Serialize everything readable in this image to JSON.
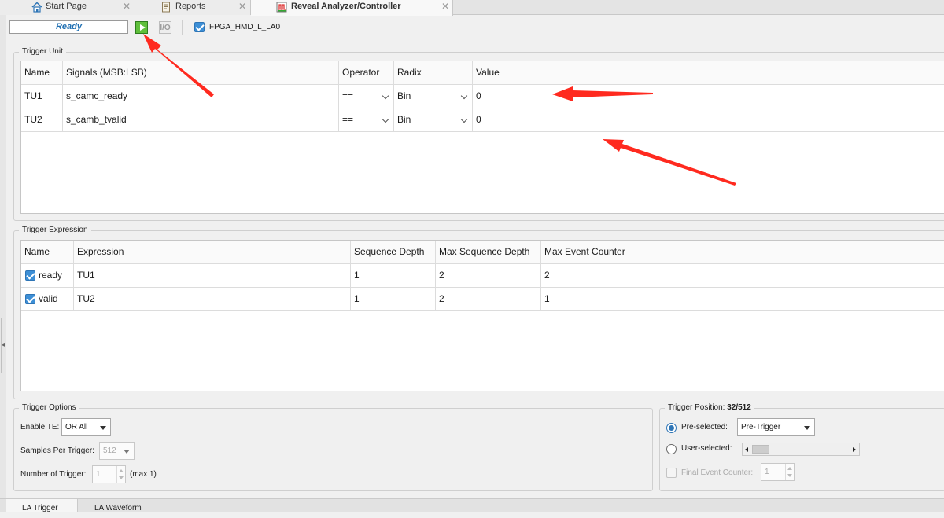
{
  "tabs": [
    {
      "label": "Start Page",
      "icon": "home-icon"
    },
    {
      "label": "Reports",
      "icon": "report-icon"
    },
    {
      "label": "Reveal Analyzer/Controller",
      "icon": "analyzer-icon"
    }
  ],
  "toolbar": {
    "status": "Ready",
    "run_icon": "run-icon",
    "io_icon": "io-icon",
    "device_checked": true,
    "device_label": "FPGA_HMD_L_LA0"
  },
  "trigger_unit": {
    "title": "Trigger Unit",
    "columns": [
      "Name",
      "Signals (MSB:LSB)",
      "Operator",
      "Radix",
      "Value"
    ],
    "rows": [
      {
        "name": "TU1",
        "signals": "s_camc_ready",
        "operator": "==",
        "radix": "Bin",
        "value": "0"
      },
      {
        "name": "TU2",
        "signals": "s_camb_tvalid",
        "operator": "==",
        "radix": "Bin",
        "value": "0"
      }
    ]
  },
  "trigger_expression": {
    "title": "Trigger Expression",
    "columns": [
      "Name",
      "Expression",
      "Sequence Depth",
      "Max Sequence Depth",
      "Max Event Counter"
    ],
    "rows": [
      {
        "checked": true,
        "name": "ready",
        "expression": "TU1",
        "sequence_depth": "1",
        "max_sequence_depth": "2",
        "max_event_counter": "2"
      },
      {
        "checked": true,
        "name": "valid",
        "expression": "TU2",
        "sequence_depth": "1",
        "max_sequence_depth": "2",
        "max_event_counter": "1"
      }
    ]
  },
  "trigger_options": {
    "title": "Trigger Options",
    "enable_te_label": "Enable TE:",
    "enable_te_value": "OR All",
    "samples_label": "Samples Per Trigger:",
    "samples_value": "512",
    "num_trigger_label": "Number of Trigger:",
    "num_trigger_value": "1",
    "num_trigger_max": "(max 1)"
  },
  "trigger_position": {
    "title_prefix": "Trigger Position:",
    "title_value": "32/512",
    "preselected_label": "Pre-selected:",
    "preselected_value": "Pre-Trigger",
    "preselected_checked": true,
    "userselected_label": "User-selected:",
    "final_event_label": "Final Event Counter:",
    "final_event_value": "1"
  },
  "bottom_tabs": [
    "LA Trigger",
    "LA Waveform"
  ],
  "colors": {
    "accent": "#2e75b6",
    "status_text": "#1f6fb2",
    "annotation": "#ff2a1f"
  }
}
